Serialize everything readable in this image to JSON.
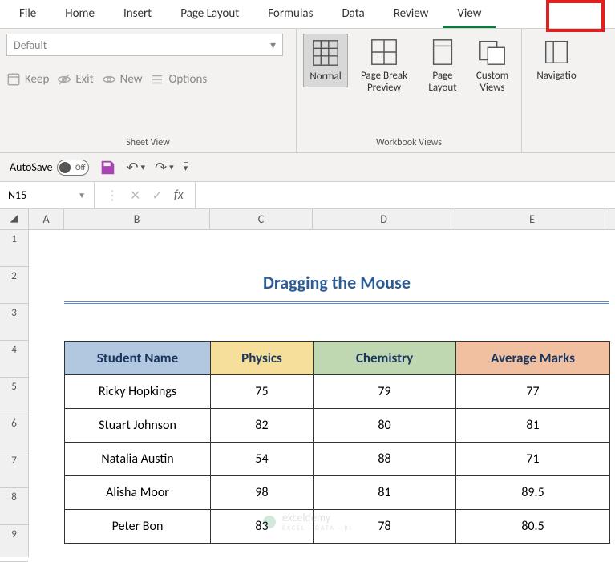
{
  "ribbon": {
    "tabs": [
      "File",
      "Home",
      "Insert",
      "Page Layout",
      "Formulas",
      "Data",
      "Review",
      "View"
    ],
    "active_tab": "View",
    "sheet_view": {
      "dropdown_value": "Default",
      "keep": "Keep",
      "exit": "Exit",
      "new": "New",
      "options": "Options",
      "group_label": "Sheet View"
    },
    "workbook_views": {
      "normal": "Normal",
      "page_break": "Page Break\nPreview",
      "page_layout": "Page\nLayout",
      "custom_views": "Custom\nViews",
      "group_label": "Workbook Views"
    },
    "navigation": "Navigatio"
  },
  "qat": {
    "autosave_label": "AutoSave",
    "autosave_state": "Off"
  },
  "formula_bar": {
    "name_box": "N15",
    "fx_label": "fx",
    "formula": ""
  },
  "grid": {
    "columns": [
      "A",
      "B",
      "C",
      "D",
      "E"
    ],
    "rows": [
      "1",
      "2",
      "3",
      "4",
      "5",
      "6",
      "7",
      "8",
      "9"
    ],
    "title": "Dragging the Mouse",
    "headers": {
      "b": "Student Name",
      "c": "Physics",
      "d": "Chemistry",
      "e": "Average Marks"
    },
    "data": [
      {
        "b": "Ricky Hopkings",
        "c": "75",
        "d": "79",
        "e": "77"
      },
      {
        "b": "Stuart Johnson",
        "c": "82",
        "d": "80",
        "e": "81"
      },
      {
        "b": "Natalia Austin",
        "c": "54",
        "d": "88",
        "e": "71"
      },
      {
        "b": "Alisha Moor",
        "c": "98",
        "d": "81",
        "e": "89.5"
      },
      {
        "b": "Peter Bon",
        "c": "83",
        "d": "78",
        "e": "80.5"
      }
    ]
  },
  "watermark": {
    "brand": "exceldemy",
    "tag": "EXCEL · DATA · BI"
  },
  "chart_data": {
    "type": "table",
    "title": "Dragging the Mouse",
    "columns": [
      "Student Name",
      "Physics",
      "Chemistry",
      "Average Marks"
    ],
    "rows": [
      [
        "Ricky Hopkings",
        75,
        79,
        77
      ],
      [
        "Stuart Johnson",
        82,
        80,
        81
      ],
      [
        "Natalia Austin",
        54,
        88,
        71
      ],
      [
        "Alisha Moor",
        98,
        81,
        89.5
      ],
      [
        "Peter Bon",
        83,
        78,
        80.5
      ]
    ]
  }
}
